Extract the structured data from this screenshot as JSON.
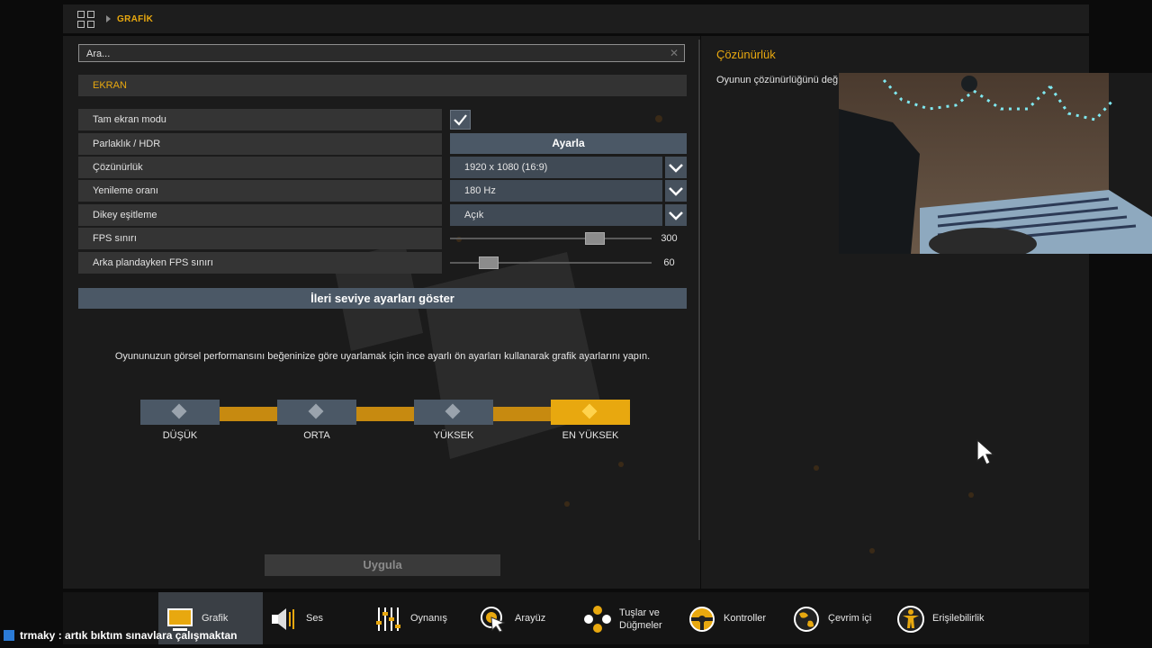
{
  "breadcrumb": {
    "current": "GRAFİK"
  },
  "search": {
    "placeholder": "Ara..."
  },
  "section": {
    "title": "EKRAN"
  },
  "settings": {
    "fullscreen": {
      "label": "Tam ekran modu",
      "checked": true
    },
    "brightness": {
      "label": "Parlaklık / HDR",
      "button": "Ayarla"
    },
    "resolution": {
      "label": "Çözünürlük",
      "value": "1920 x 1080 (16:9)"
    },
    "refresh": {
      "label": "Yenileme oranı",
      "value": "180 Hz"
    },
    "vsync": {
      "label": "Dikey eşitleme",
      "value": "Açık"
    },
    "fps_limit": {
      "label": "FPS sınırı",
      "value": "300"
    },
    "bg_fps_limit": {
      "label": "Arka plandayken FPS sınırı",
      "value": "60"
    }
  },
  "advanced_button": "İleri seviye ayarları göster",
  "preset": {
    "description": "Oyununuzun görsel performansını beğeninize göre uyarlamak için ince ayarlı ön ayarları kullanarak grafik ayarlarını yapın.",
    "options": [
      "DÜŞÜK",
      "ORTA",
      "YÜKSEK",
      "EN YÜKSEK"
    ],
    "selected": "EN YÜKSEK"
  },
  "apply_button": "Uygula",
  "help": {
    "title": "Çözünürlük",
    "description": "Oyunun çözünürlüğünü değ"
  },
  "nav": [
    {
      "label": "Grafik",
      "icon": "monitor-icon",
      "active": true
    },
    {
      "label": "Ses",
      "icon": "speaker-icon"
    },
    {
      "label": "Oynanış",
      "icon": "sliders-icon"
    },
    {
      "label": "Arayüz",
      "icon": "cursor-target-icon"
    },
    {
      "label": "Tuşlar ve Düğmeler",
      "icon": "gamepad-buttons-icon"
    },
    {
      "label": "Kontroller",
      "icon": "steering-wheel-icon"
    },
    {
      "label": "Çevrim içi",
      "icon": "globe-icon"
    },
    {
      "label": "Erişilebilirlik",
      "icon": "accessibility-icon"
    }
  ],
  "chat": {
    "user": "trmaky",
    "message": "artık bıktım sınavlara çalışmaktan"
  },
  "colors": {
    "accent": "#e8a80f",
    "button": "#4b5866",
    "panel": "#1b1b1b"
  }
}
